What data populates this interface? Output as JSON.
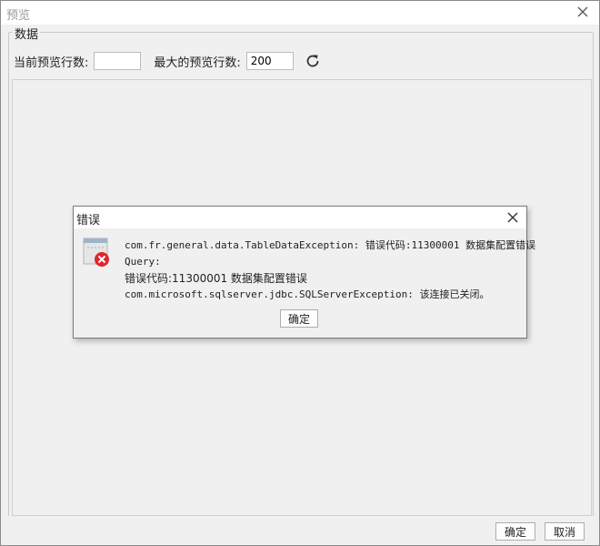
{
  "preview_window": {
    "title": "预览",
    "close_icon": "close-icon",
    "group_label": "数据",
    "current_rows_label": "当前预览行数:",
    "current_rows_value": "",
    "max_rows_label": "最大的预览行数:",
    "max_rows_value": "200",
    "refresh_icon": "refresh-icon",
    "ok_label": "确定",
    "cancel_label": "取消"
  },
  "error_dialog": {
    "title": "错误",
    "close_icon": "close-icon",
    "icon": "error-icon",
    "lines": [
      "com.fr.general.data.TableDataException: 错误代码:11300001 数据集配置错误",
      "Query:",
      "错误代码:11300001 数据集配置错误",
      "com.microsoft.sqlserver.jdbc.SQLServerException: 该连接已关闭。"
    ],
    "ok_label": "确定"
  },
  "colors": {
    "window_bg": "#f0f0f0",
    "error_red": "#e0262b",
    "border": "#8a8a8a"
  }
}
